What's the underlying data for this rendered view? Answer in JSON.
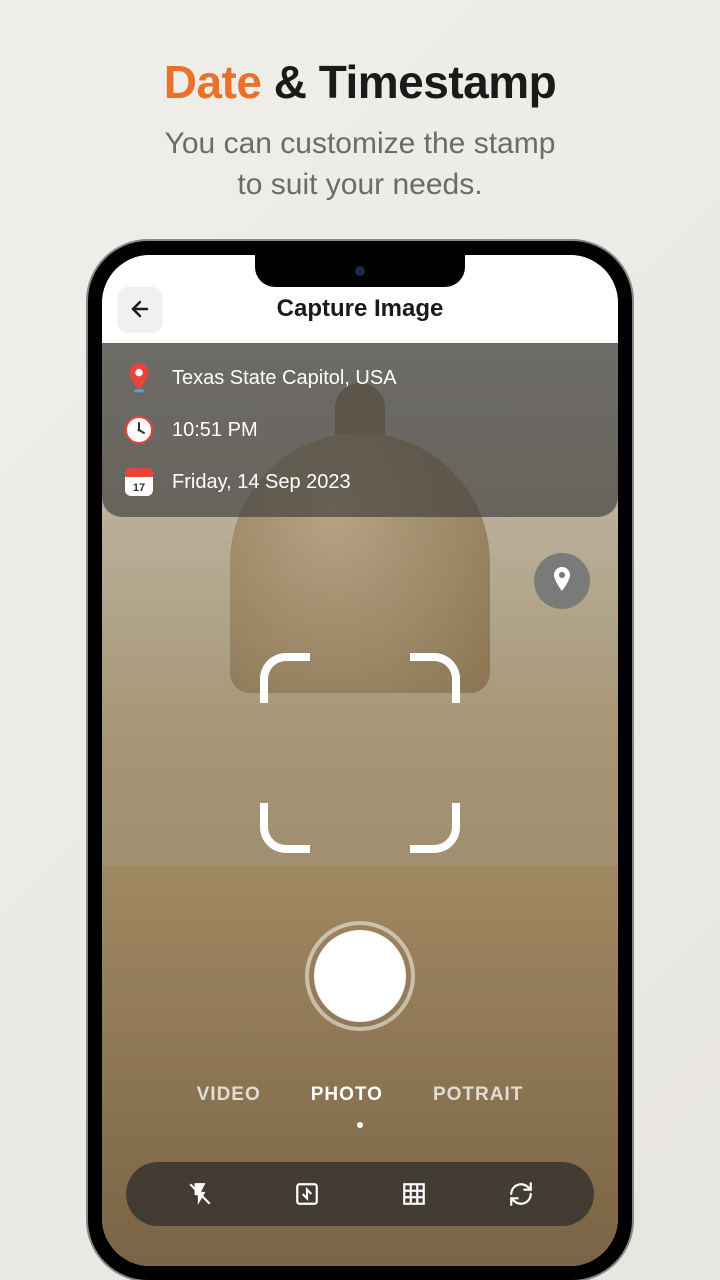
{
  "headline": {
    "accent": "Date",
    "rest": " & Timestamp"
  },
  "subtitle": "You can customize the stamp\nto suit your needs.",
  "app": {
    "title": "Capture Image",
    "info": {
      "location": "Texas State Capitol, USA",
      "time": "10:51 PM",
      "date": "Friday, 14 Sep 2023",
      "calendar_day": "17"
    },
    "modes": {
      "video": "VIDEO",
      "photo": "PHOTO",
      "portrait": "POTRAIT"
    }
  }
}
